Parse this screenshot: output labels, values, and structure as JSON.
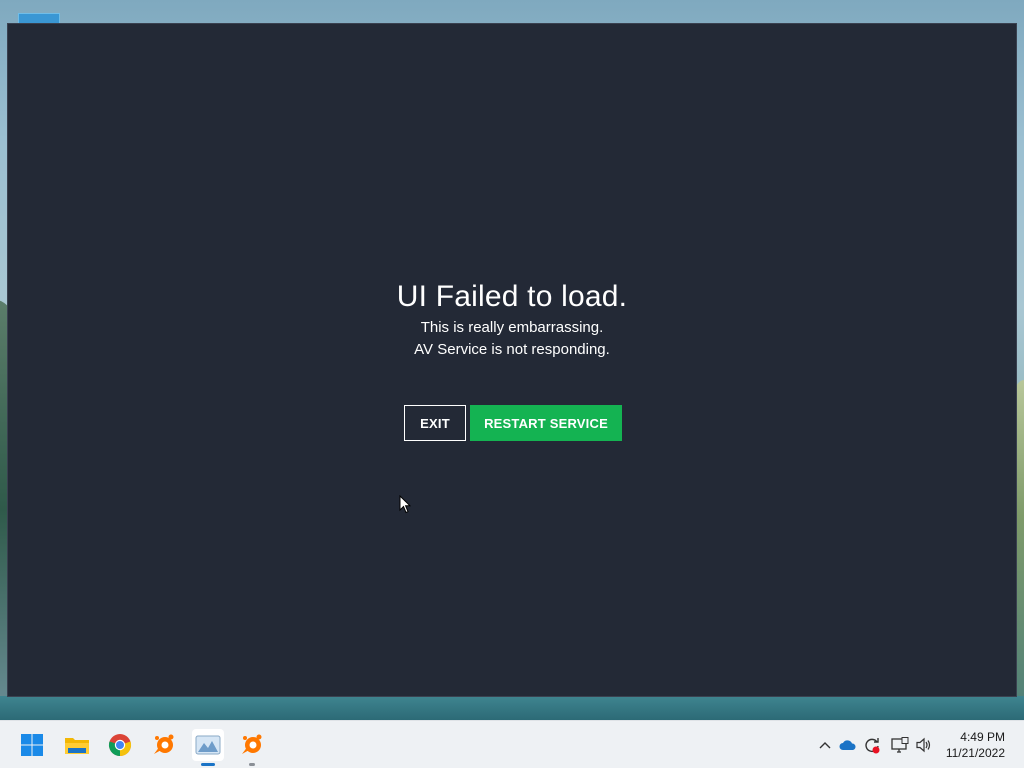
{
  "dialog": {
    "title": "UI Failed to load.",
    "line1": "This is really embarrassing.",
    "line2": "AV Service is not responding.",
    "exit_label": "EXIT",
    "restart_label": "RESTART SERVICE"
  },
  "colors": {
    "window_bg": "#232936",
    "accent_green": "#14b352",
    "taskbar_bg": "#eef1f4"
  },
  "taskbar": {
    "apps": [
      "start-icon",
      "file-explorer-icon",
      "chrome-icon",
      "avast-icon",
      "photos-icon",
      "avast-icon"
    ],
    "tray": [
      "chevron-up-icon",
      "onedrive-icon",
      "sync-icon",
      "network-icon",
      "volume-icon"
    ],
    "time": "4:49 PM",
    "date": "11/21/2022"
  }
}
